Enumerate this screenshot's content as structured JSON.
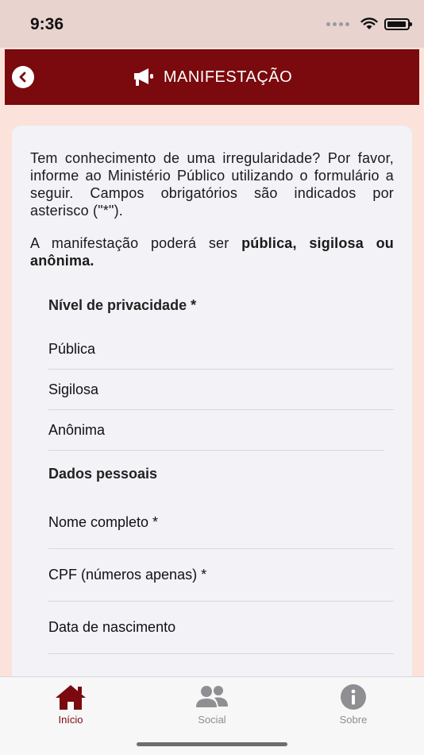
{
  "status": {
    "time": "9:36"
  },
  "header": {
    "title": "MANIFESTAÇÃO"
  },
  "intro": {
    "paragraph1": "Tem conhecimento de uma irregularidade? Por favor, informe ao Ministério Público utilizando o formulário a seguir. Campos obrigatórios são indicados por asterisco (\"*\").",
    "paragraph2_prefix": "A manifestação poderá ser ",
    "paragraph2_bold": "pública, sigilosa ou anônima."
  },
  "privacy": {
    "title": "Nível de privacidade *",
    "options": [
      "Pública",
      "Sigilosa",
      "Anônima"
    ]
  },
  "personal": {
    "title": "Dados pessoais",
    "fields": [
      "Nome completo *",
      "CPF (números apenas) *",
      "Data de nascimento"
    ]
  },
  "tabs": [
    {
      "label": "Início",
      "icon": "home-icon"
    },
    {
      "label": "Social",
      "icon": "people-icon"
    },
    {
      "label": "Sobre",
      "icon": "info-icon"
    }
  ],
  "colors": {
    "brand": "#7a0a0d",
    "background": "#fbe3dc",
    "inactive_tab": "#8e8e93"
  }
}
